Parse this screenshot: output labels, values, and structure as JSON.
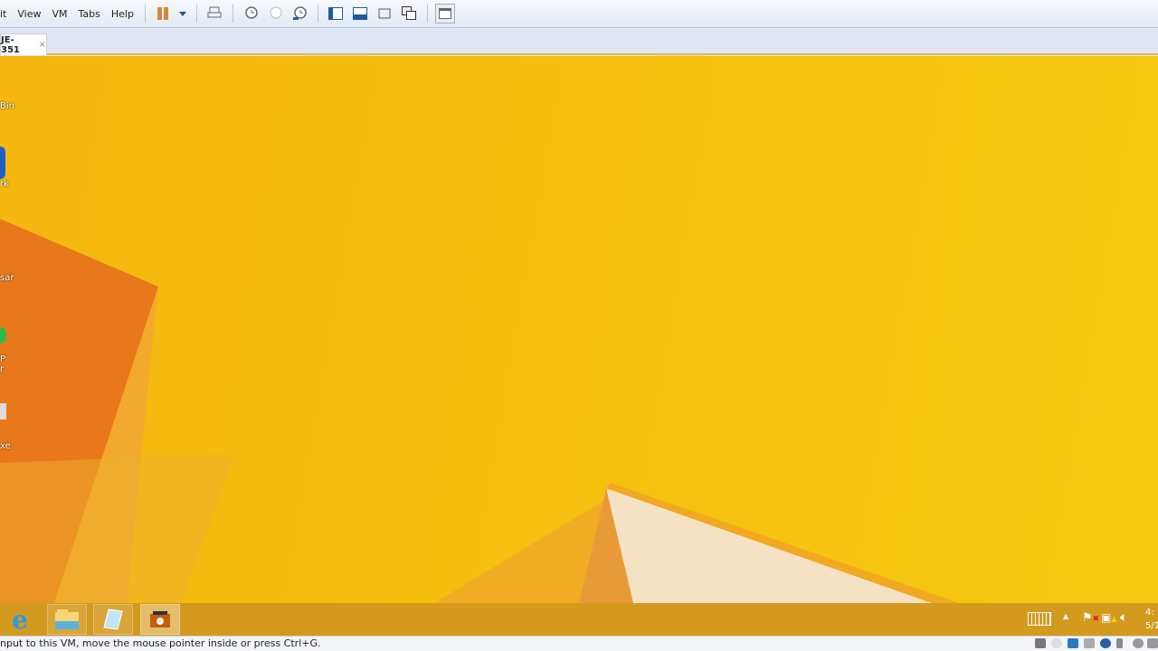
{
  "menubar": {
    "items": [
      "it",
      "View",
      "VM",
      "Tabs",
      "Help"
    ]
  },
  "tab": {
    "label": "JE-351",
    "close": "×"
  },
  "desktop": {
    "icons": [
      "Bin",
      "rk",
      "sar",
      "P",
      "r",
      "xe"
    ]
  },
  "tray": {
    "time": "4:",
    "date": "5/1"
  },
  "status": {
    "text": "nput to this VM, move the mouse pointer inside or press Ctrl+G."
  },
  "colors": {
    "wallpaper": "#f5c20f",
    "taskbar": "#d49a1e",
    "accent": "#e6b84a"
  }
}
